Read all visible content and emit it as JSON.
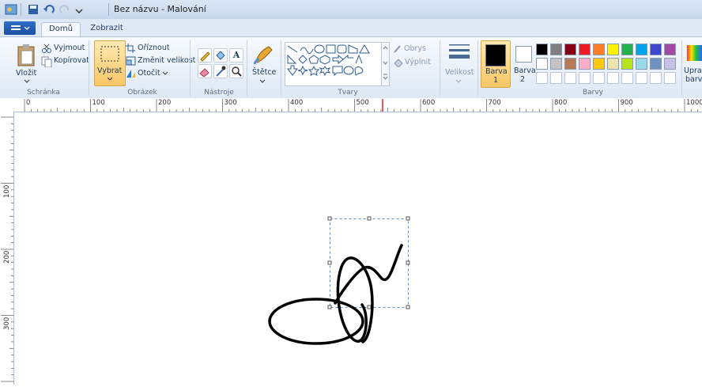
{
  "window": {
    "title": "Bez názvu - Malování"
  },
  "tabs": [
    {
      "label": "Domů"
    },
    {
      "label": "Zobrazit"
    }
  ],
  "clipboard": {
    "paste": "Vložit",
    "cut": "Vyjmout",
    "copy": "Kopírovat",
    "group": "Schránka"
  },
  "image": {
    "select": "Vybrat",
    "crop": "Oříznout",
    "resize": "Změnit velikost",
    "rotate": "Otočit",
    "group": "Obrázek"
  },
  "tools": {
    "group": "Nástroje",
    "text_glyph": "A"
  },
  "brushes": {
    "label": "Štětce"
  },
  "shapes": {
    "outline": "Obrys",
    "fill": "Výplnit",
    "group": "Tvary"
  },
  "size": {
    "label": "Velikost"
  },
  "color1": {
    "label": "Barva",
    "num": "1"
  },
  "color2": {
    "label": "Barva",
    "num": "2"
  },
  "colors": {
    "group": "Barvy",
    "edit_line1": "Uprav",
    "edit_line2": "barv",
    "row1": [
      "#000000",
      "#7f7f7f",
      "#880015",
      "#ed1c24",
      "#ff7f27",
      "#fff200",
      "#22b14c",
      "#00a2e8",
      "#3f48cc",
      "#a349a4"
    ],
    "row2": [
      "#ffffff",
      "#c3c3c3",
      "#b97a57",
      "#ffaec9",
      "#ffc90e",
      "#efe4b0",
      "#b5e61d",
      "#99d9ea",
      "#7092be",
      "#c8bfe7"
    ]
  },
  "ruler": {
    "h": [
      "0",
      "100",
      "200",
      "300",
      "400",
      "500",
      "600",
      "700",
      "800",
      "900",
      "1000"
    ],
    "v": [
      "100",
      "200",
      "300"
    ]
  }
}
